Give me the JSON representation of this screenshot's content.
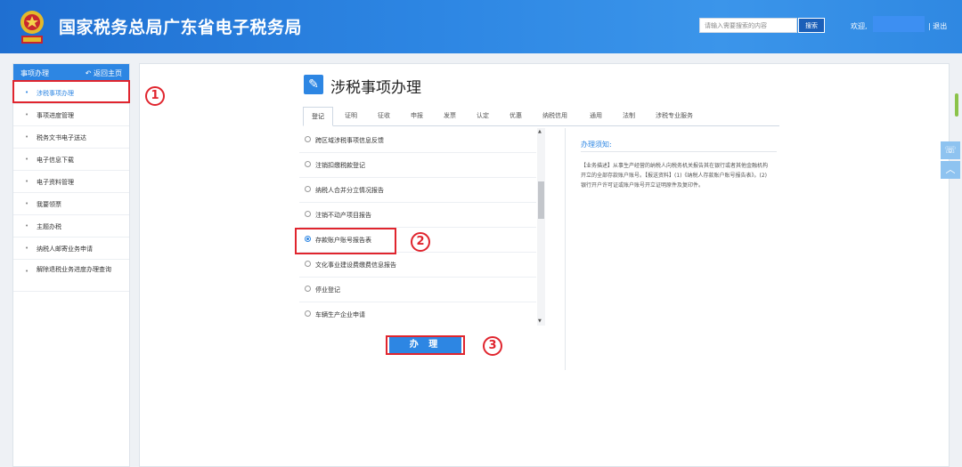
{
  "header": {
    "title": "国家税务总局广东省电子税务局",
    "search_placeholder": "请输入需要搜索的内容",
    "search_button": "搜索",
    "welcome": "欢迎,",
    "logout": "| 退出"
  },
  "sidebar": {
    "title": "事项办理",
    "back_label": "返回主页",
    "items": [
      {
        "label": "涉税事项办理",
        "active": true
      },
      {
        "label": "事项进度管理"
      },
      {
        "label": "税务文书电子送达"
      },
      {
        "label": "电子信息下载"
      },
      {
        "label": "电子资料管理"
      },
      {
        "label": "我要领票"
      },
      {
        "label": "主题办税"
      },
      {
        "label": "纳税人邮寄业务申请"
      },
      {
        "label": "解除退税业务进度办理查询"
      }
    ]
  },
  "main": {
    "page_title": "涉税事项办理",
    "tabs": [
      "登记",
      "证明",
      "征收",
      "申报",
      "发票",
      "认定",
      "优惠",
      "纳税信用",
      "通用",
      "法制",
      "涉税专业服务"
    ],
    "active_tab": "登记",
    "items": [
      "跨区域涉税事项信息反馈",
      "注销扣缴税款登记",
      "纳税人合并分立情况报告",
      "注销不动产项目报告",
      "存款账户账号报告表",
      "文化事业建设费缴费信息报告",
      "停业登记",
      "车辆生产企业申请"
    ],
    "selected_item": "存款账户账号报告表",
    "submit_button": "办 理"
  },
  "notes": {
    "title": "办理须知:",
    "body": "【业务描述】从事生产经营的纳税人向税务机关报告其在银行或者其他金融机构开立的全部存款账户账号。【报送资料】(1)《纳税人存款账户账号报告表》。(2)银行开户许可证或账户账号开立证明原件及复印件。"
  },
  "annotations": {
    "step1": "1",
    "step2": "2",
    "step3": "3"
  },
  "icons": {
    "edit": "edit-icon",
    "back": "back-arrow-icon",
    "wechat": "wechat-icon",
    "to_top": "chevron-up-icon"
  },
  "colors": {
    "primary": "#2d86e3",
    "highlight": "#e0252e"
  }
}
